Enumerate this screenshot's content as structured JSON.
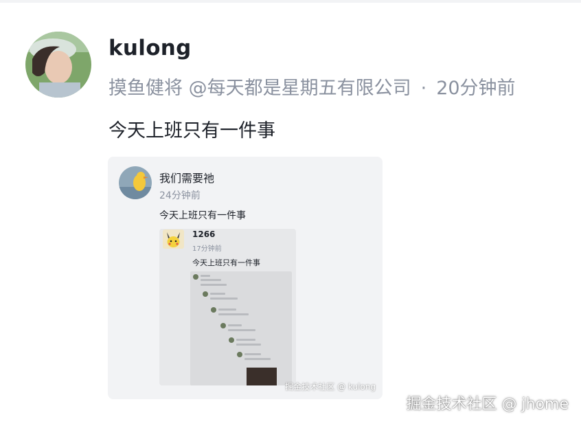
{
  "post": {
    "author": "kulong",
    "meta_text": "摸鱼健将 @每天都是星期五有限公司",
    "dot": "·",
    "time": "20分钟前",
    "content": "今天上班只有一件事"
  },
  "quote": {
    "author": "我们需要祂",
    "time": "24分钟前",
    "content": "今天上班只有一件事",
    "watermark": "掘金技术社区 @ kulong",
    "inner": {
      "author": "1266",
      "time": "17分钟前",
      "content": "今天上班只有一件事"
    }
  },
  "watermark": "掘金技术社区 @ jhome"
}
